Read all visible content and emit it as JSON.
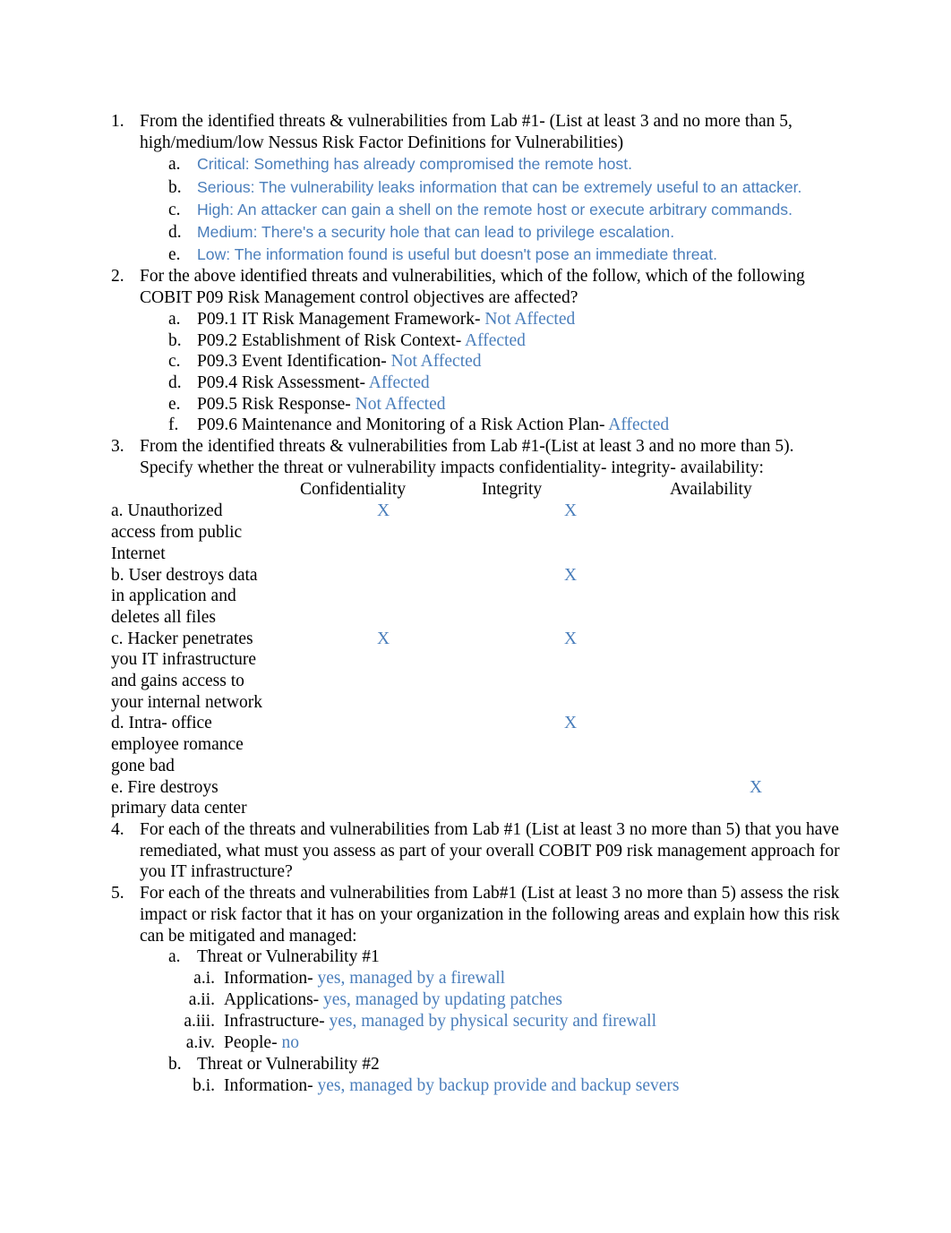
{
  "document": {
    "items": [
      {
        "marker": "1.",
        "text": "From the identified threats & vulnerabilities from Lab #1- (List at least 3 and no more than 5, high/medium/low Nessus Risk Factor Definitions for Vulnerabilities)",
        "subitems": [
          {
            "marker": "a.",
            "text": "Critical: Something has already compromised the remote host.",
            "color": "#4a7ebb"
          },
          {
            "marker": "b.",
            "text": " Serious: The vulnerability leaks information that can be extremely useful to an attacker.",
            "color": "#4a7ebb"
          },
          {
            "marker": "c.",
            "text": "High: An attacker can gain a shell on the remote host or execute arbitrary commands.",
            "color": "#4a7ebb"
          },
          {
            "marker": "d.",
            "text": " Medium: There's a security hole that can lead to privilege escalation.",
            "color": "#4a7ebb"
          },
          {
            "marker": "e.",
            "text": " Low: The information found is useful but doesn't pose an immediate threat.",
            "color": "#4a7ebb"
          }
        ]
      },
      {
        "marker": "2.",
        "text": "For the above identified threats and vulnerabilities, which of the follow, which of the following COBIT P09 Risk Management control objectives are affected?",
        "subitems": [
          {
            "marker": "a.",
            "label": "P09.1 IT Risk Management Framework-",
            "answer": " Not Affected"
          },
          {
            "marker": "b.",
            "label": "P09.2 Establishment of Risk Context-",
            "answer": " Affected"
          },
          {
            "marker": "c.",
            "label": "P09.3 Event Identification-",
            "answer": " Not Affected"
          },
          {
            "marker": "d.",
            "label": "P09.4 Risk Assessment-",
            "answer": " Affected"
          },
          {
            "marker": "e.",
            "label": "P09.5 Risk Response-",
            "answer": " Not Affected"
          },
          {
            "marker": "f.",
            "label": "P09.6 Maintenance and Monitoring of a Risk Action Plan-",
            "answer": " Affected"
          }
        ]
      },
      {
        "marker": "3.",
        "text": "From the identified threats & vulnerabilities from Lab #1-(List at least 3 and no more than 5). Specify whether the threat or vulnerability impacts confidentiality- integrity- availability:"
      },
      {
        "marker": "4.",
        "text": "For each of the threats and vulnerabilities from Lab #1 (List at least 3 no more than 5) that you have remediated, what must you assess as part of your overall COBIT P09 risk management approach for you IT infrastructure?"
      },
      {
        "marker": "5.",
        "text": "For each of the threats and vulnerabilities from Lab#1 (List at least 3 no more than 5) assess the risk impact or risk factor that it has on your organization in the following areas and explain how this risk can be mitigated and managed:",
        "threats": [
          {
            "marker": "a.",
            "title": "Threat or Vulnerability #1",
            "areas": [
              {
                "marker": "a.i.",
                "label": "Information-",
                "answer": " yes, managed by a firewall"
              },
              {
                "marker": "a.ii.",
                "label": "Applications-",
                "answer": " yes, managed by updating patches"
              },
              {
                "marker": "a.iii.",
                "label": "Infrastructure-",
                "answer": " yes, managed by physical security and firewall"
              },
              {
                "marker": "a.iv.",
                "label": "People-",
                "answer": " no"
              }
            ]
          },
          {
            "marker": "b.",
            "title": "Threat or Vulnerability #2",
            "areas": [
              {
                "marker": "b.i.",
                "label": "Information-",
                "answer": " yes, managed by backup provide and backup severs"
              }
            ]
          }
        ]
      }
    ],
    "cia_table": {
      "columns": [
        "Confidentiality",
        "Integrity",
        "Availability"
      ],
      "rows": [
        {
          "label": "a. Unauthorized\naccess from public\nInternet",
          "confidentiality": "X",
          "integrity": "X",
          "availability": ""
        },
        {
          "label": "b. User destroys data\nin application and\ndeletes all files",
          "confidentiality": "",
          "integrity": "X",
          "availability": ""
        },
        {
          "label": "c. Hacker penetrates\nyou IT infrastructure\nand gains access to\nyour internal network",
          "confidentiality": "X",
          "integrity": "X",
          "availability": ""
        },
        {
          "label": "d. Intra- office\nemployee romance\ngone bad",
          "confidentiality": "",
          "integrity": "X",
          "availability": ""
        },
        {
          "label": "e. Fire destroys\nprimary data center",
          "confidentiality": "",
          "integrity": "",
          "availability": "X"
        }
      ]
    },
    "colors": {
      "answer_blue": "#4a7ebb",
      "body_black": "#000000"
    }
  }
}
